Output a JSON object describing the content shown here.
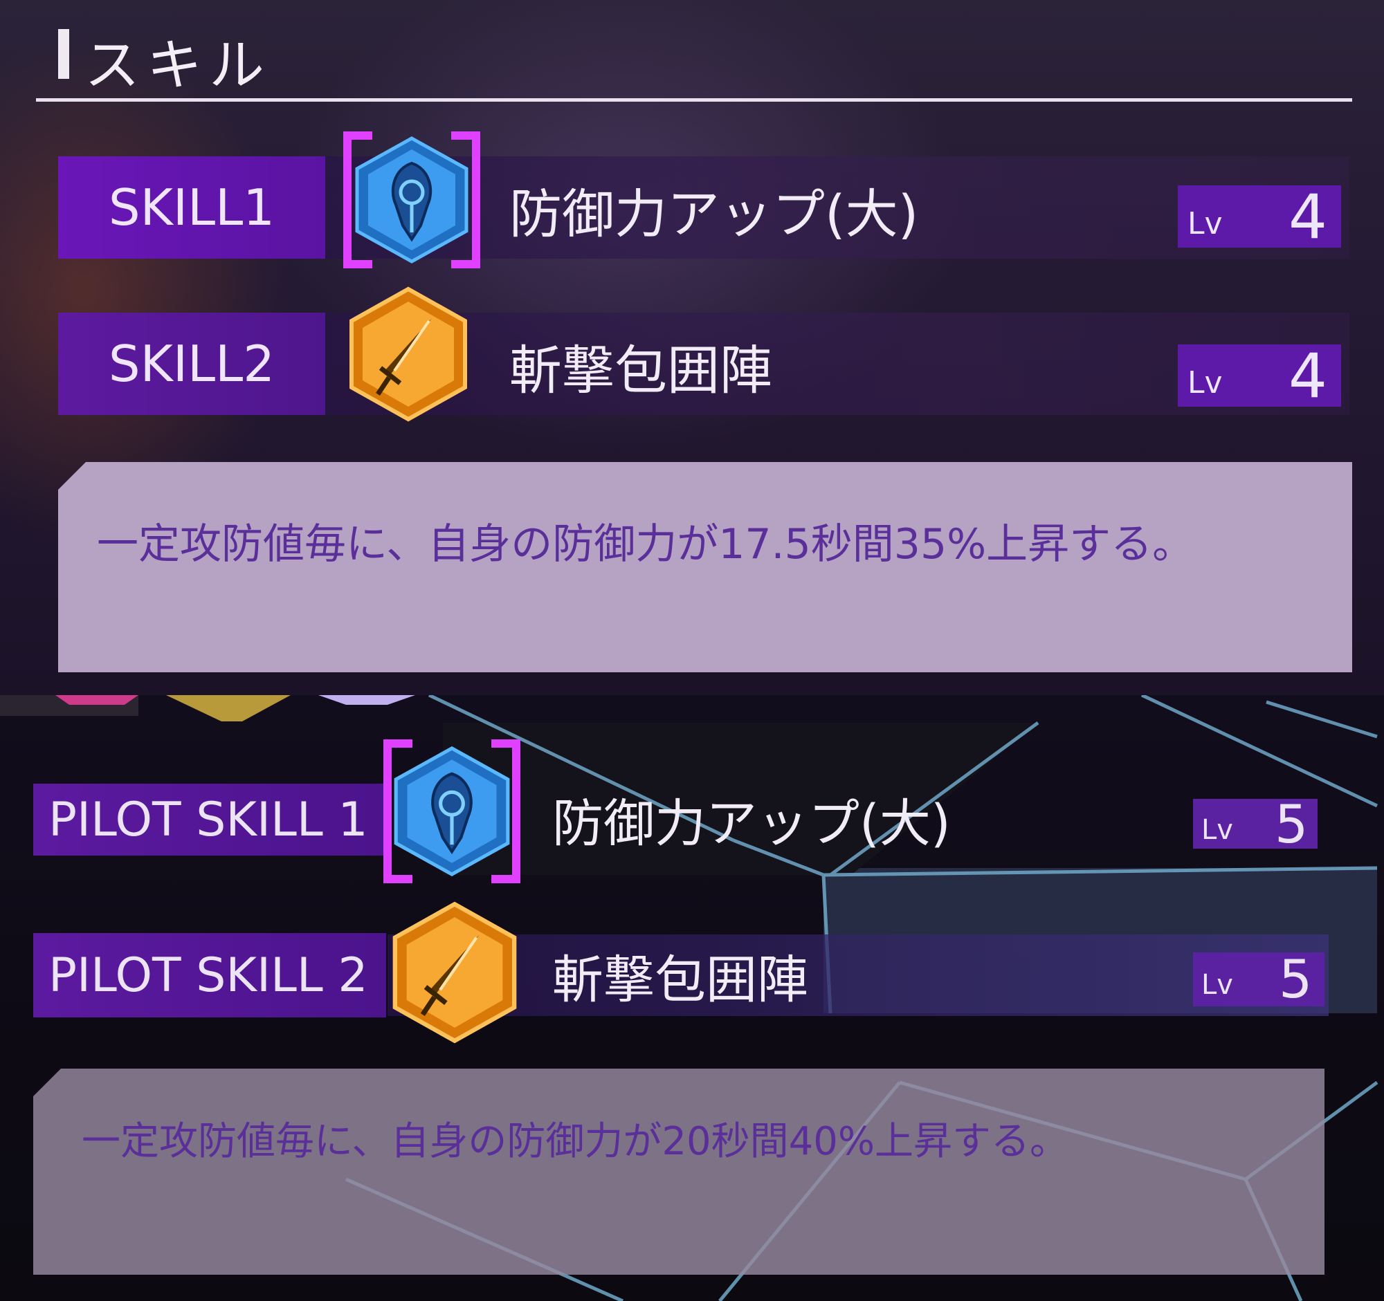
{
  "section": {
    "title": "スキル"
  },
  "top": {
    "skills": [
      {
        "label": "SKILL1",
        "name": "防御力アップ(大)",
        "lv_prefix": "Lv",
        "lv": "4",
        "icon": "shield-icon"
      },
      {
        "label": "SKILL2",
        "name": "斬撃包囲陣",
        "lv_prefix": "Lv",
        "lv": "4",
        "icon": "sword-icon"
      }
    ],
    "description": "一定攻防値毎に、自身の防御力が17.5秒間35%上昇する。"
  },
  "bottom": {
    "skills": [
      {
        "label": "PILOT SKILL 1",
        "name": "防御力アップ(大)",
        "lv_prefix": "Lv",
        "lv": "5",
        "icon": "shield-icon"
      },
      {
        "label": "PILOT SKILL 2",
        "name": "斬撃包囲陣",
        "lv_prefix": "Lv",
        "lv": "5",
        "icon": "sword-icon"
      }
    ],
    "description": "一定攻防値毎に、自身の防御力が20秒間40%上昇する。"
  },
  "colors": {
    "label_purple": "#6a16b8",
    "lv_purple": "#5d1aa8",
    "shield_blue": "#2f8fe0",
    "sword_orange": "#f29a1c",
    "selection_magenta": "#e040ff",
    "description_bg": "#b6a3c4",
    "description_text": "#5a2f9a"
  }
}
